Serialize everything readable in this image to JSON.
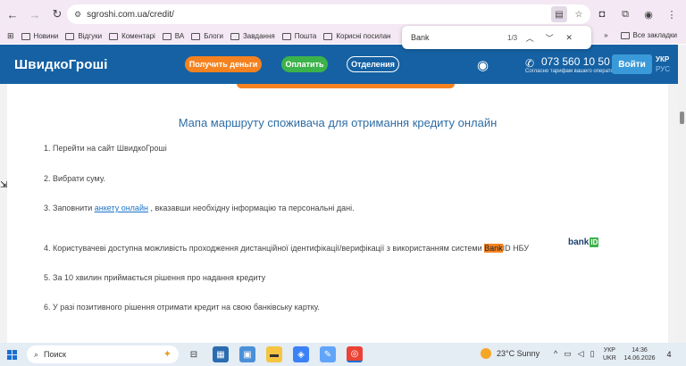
{
  "browser": {
    "url": "sgroshi.com.ua/credit/",
    "bookmarks": [
      "Новини",
      "Відгуки",
      "Коментарі",
      "ВА",
      "Блоги",
      "Завдання",
      "Пошта",
      "Корисні посилан"
    ],
    "all_bookmarks": "Все закладки",
    "more": "»"
  },
  "find": {
    "query": "Bank",
    "count": "1/3"
  },
  "site": {
    "logo": "ШвидкоГроші",
    "btn_get_money": "Получить деньги",
    "btn_pay": "Оплатить",
    "btn_branches": "Отделения",
    "phone": "073 560 10 50",
    "phone_note": "Согласно тарифам вашего оператора",
    "login": "Войти",
    "lang_active": "УКР",
    "lang_other": "РУС"
  },
  "content": {
    "title": "Мапа маршруту споживача для отримання кредиту онлайн",
    "step1": "1. Перейти на сайт ШвидкоГроші",
    "step2": "2. Вибрати суму.",
    "step3_prefix": "3. Заповнити ",
    "step3_link": "анкету онлайн",
    "step3_suffix": " , вказавши необхідну інформацію та персональні дані.",
    "step4_prefix": "4. Користувачеві доступна можливість проходження дистанційної ідентифікації/верифікації з використанням системи ",
    "step4_highlight": "Bank",
    "step4_suffix": "ID НБУ",
    "bankid_logo_text": "bank",
    "bankid_logo_box": "ID",
    "step5": "5. За 10 хвилин приймається рішення про надання кредиту",
    "step6": "6. У разі позитивного рішення отримати кредит на свою банківську картку."
  },
  "taskbar": {
    "search_placeholder": "Поиск",
    "weather": "23°C  Sunny",
    "kbd1": "УКР",
    "kbd2": "UKR",
    "time": "14:36",
    "date": "14.06.2026",
    "notifications": "4"
  },
  "colors": {
    "header_blue": "#1561a3",
    "accent_orange": "#f58220",
    "accent_green": "#3cb34a",
    "title_blue": "#2e6da4"
  }
}
